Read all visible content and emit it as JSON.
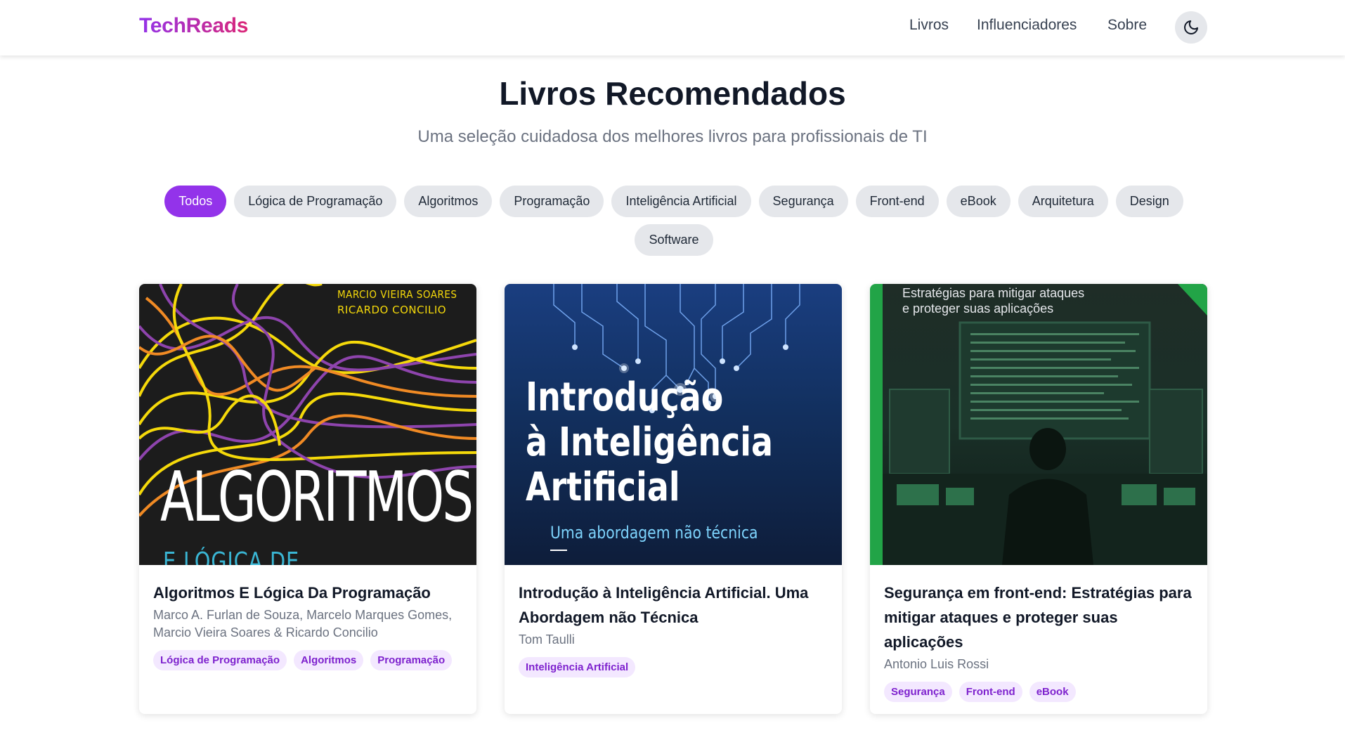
{
  "header": {
    "brand": "TechReads",
    "nav": [
      "Livros",
      "Influenciadores",
      "Sobre"
    ],
    "theme_toggle_icon": "moon-icon"
  },
  "hero": {
    "title": "Livros Recomendados",
    "subtitle": "Uma seleção cuidadosa dos melhores livros para profissionais de TI"
  },
  "filters": {
    "active": "Todos",
    "items": [
      "Todos",
      "Lógica de Programação",
      "Algoritmos",
      "Programação",
      "Inteligência Artificial",
      "Segurança",
      "Front-end",
      "eBook",
      "Arquitetura",
      "Design",
      "Software"
    ]
  },
  "books": [
    {
      "title": "Algoritmos E Lógica Da Programação",
      "author": "Marco A. Furlan de Souza, Marcelo Marques Gomes, Marcio Vieira Soares & Ricardo Concilio",
      "tags": [
        "Lógica de Programação",
        "Algoritmos",
        "Programação"
      ],
      "cover": {
        "author1": "MARCIO VIEIRA SOARES",
        "author2": "RICARDO CONCILIO",
        "title": "ALGORITMOS",
        "subtitle": "E LÓGICA DE PROGRAMAÇÃO"
      }
    },
    {
      "title": "Introdução à Inteligência Artificial. Uma Abordagem não Técnica",
      "author": "Tom Taulli",
      "tags": [
        "Inteligência Artificial"
      ],
      "cover": {
        "title_lines": [
          "Introdução",
          "à Inteligência",
          "Artificial"
        ],
        "subtitle": "Uma abordagem não técnica"
      }
    },
    {
      "title": "Segurança em front-end: Estratégias para mitigar ataques e proteger suas aplicações",
      "author": "Antonio Luis Rossi",
      "tags": [
        "Segurança",
        "Front-end",
        "eBook"
      ],
      "cover": {
        "text_lines": [
          "Estratégias para mitigar ataques",
          "e proteger suas aplicações"
        ]
      }
    }
  ],
  "colors": {
    "brand_start": "#9333ea",
    "brand_end": "#db2777",
    "accent": "#9333ea",
    "tag_bg": "#f3e8ff",
    "tag_text": "#7e22ce"
  }
}
